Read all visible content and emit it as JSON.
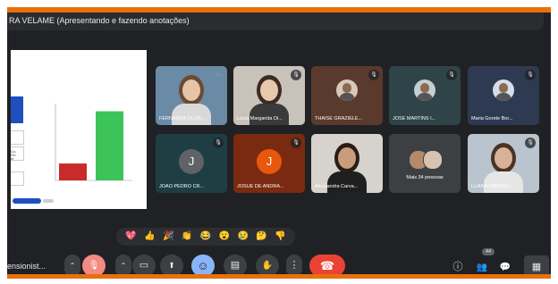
{
  "meeting": {
    "presenter_strip": "RA VELAME (Apresentando e fazendo anotações)",
    "meeting_name": "ensionist..."
  },
  "slide": {
    "side_text": "Co-\nFin\nIn",
    "chart_data": {
      "type": "bar",
      "categories": [
        "",
        ""
      ],
      "series": [
        {
          "name": "",
          "values": [
            22
          ],
          "color": "#c92a2a"
        },
        {
          "name": "",
          "values": [
            90
          ],
          "color": "#3cc45a"
        }
      ],
      "ylim": [
        0,
        100
      ],
      "title": "",
      "xlabel": "",
      "ylabel": ""
    }
  },
  "participants": [
    {
      "name": "FERNANDA OLIVE...",
      "kind": "video",
      "bg": "#6a8aa6",
      "skin": "#e5c4a8",
      "hair": "#6b4a32",
      "shirt": "#d9d9d9",
      "badge": "blue-dots"
    },
    {
      "name": "Lúcia Margarida Di...",
      "kind": "video",
      "bg": "#c8c3ba",
      "skin": "#e8c9ad",
      "hair": "#3b2b22",
      "shirt": "#3a3a3a",
      "badge": "mic-off"
    },
    {
      "name": "THAISE GRAZIELE...",
      "kind": "photo",
      "bg": "#5a3a2c",
      "photo_bg": "#d9c8b8",
      "badge": "mic-off"
    },
    {
      "name": "JOSÉ MARTINS I...",
      "kind": "photo",
      "bg": "#2e4448",
      "photo_bg": "#c4cfd0",
      "badge": "mic-off"
    },
    {
      "name": "Maria Gorete Bor...",
      "kind": "photo",
      "bg": "#2d3a52",
      "photo_bg": "#d7dde6",
      "badge": "mic-off"
    },
    {
      "name": "JOAO PEDRO CR...",
      "kind": "letter",
      "letter": "J",
      "bg": "#1e3e44",
      "avatar": "#5f6368",
      "badge": "mic-off"
    },
    {
      "name": "JOSUÉ DE ANDRA...",
      "kind": "letter",
      "letter": "J",
      "bg": "#7a2a10",
      "avatar": "#e8580c",
      "badge": "mic-off"
    },
    {
      "name": "Alessandra Carva...",
      "kind": "video",
      "bg": "#d6d2cc",
      "skin": "#c99c7e",
      "hair": "#2a1d17",
      "shirt": "#1f1f1f",
      "badge": "none"
    },
    {
      "name": "Mais 34 pessoas",
      "kind": "group",
      "bg": "#3c4043",
      "badge": "none"
    },
    {
      "name": "LUANA RIBEIRO ...",
      "kind": "video",
      "bg": "#b9c4cf",
      "skin": "#d8b296",
      "hair": "#4a3226",
      "shirt": "#e6e6e6",
      "badge": "mic-off"
    }
  ],
  "reactions": [
    {
      "name": "sparkling-heart",
      "glyph": "💖"
    },
    {
      "name": "thumbs-up",
      "glyph": "👍"
    },
    {
      "name": "party-popper",
      "glyph": "🎉"
    },
    {
      "name": "clapping-hands",
      "glyph": "👏"
    },
    {
      "name": "tears-of-joy",
      "glyph": "😂"
    },
    {
      "name": "surprised-face",
      "glyph": "😮"
    },
    {
      "name": "crying-face",
      "glyph": "😢"
    },
    {
      "name": "thinking-face",
      "glyph": "🤔"
    },
    {
      "name": "thumbs-down",
      "glyph": "👎"
    }
  ],
  "toolbar": {
    "people_count": "44",
    "icons": {
      "expand": "⌃",
      "mic_off": "🎙",
      "camera": "▭",
      "present": "⬆",
      "emoji": "☺",
      "captions": "▤",
      "raise_hand": "✋",
      "more": "⋮",
      "leave": "☎",
      "info": "ⓘ",
      "people": "👥",
      "chat": "💬",
      "grid": "▦"
    }
  },
  "colors": {
    "accent_orange": "#e8700c",
    "background": "#202124",
    "leave_red": "#ea4335",
    "mic_muted": "#f28b82",
    "active_blue": "#8ab4f8"
  }
}
